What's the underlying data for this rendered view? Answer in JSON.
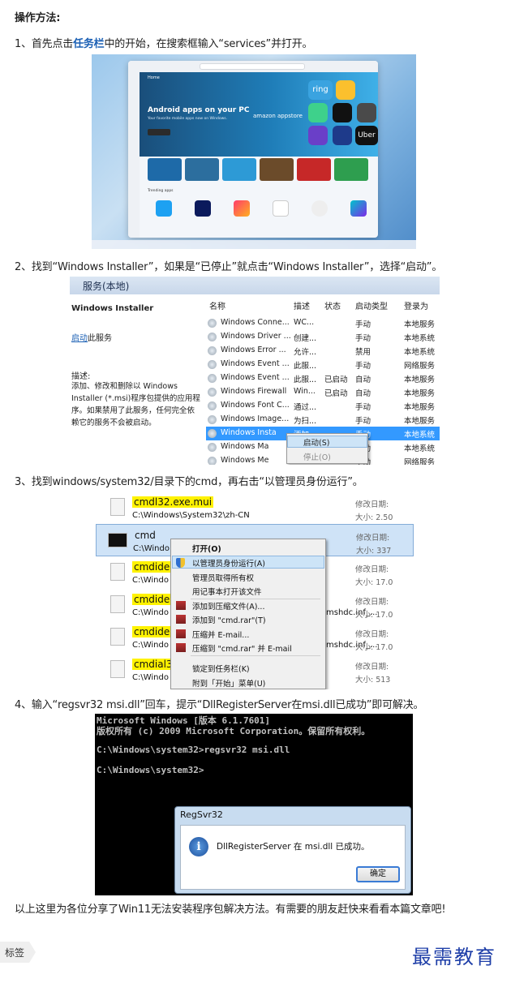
{
  "heading": "操作方法:",
  "steps": [
    {
      "pre": "1、首先点击",
      "highlight": "任务栏",
      "post": "中的开始，在搜索框输入“services”并打开。"
    },
    {
      "text": "2、找到“Windows Installer”，如果是“已停止”就点击“Windows Installer”，选择“启动”。"
    },
    {
      "text": "3、找到windows/system32/目录下的cmd，再右击“以管理员身份运行”。"
    },
    {
      "text": "4、输入“regsvr32 msi.dll”回车，提示“DllRegisterServer在msi.dll已成功”即可解决。"
    }
  ],
  "conclusion": "以上这里为各位分享了Win11无法安装程序包解决方法。有需要的朋友赶快来看看本篇文章吧!",
  "tag_label": "标签",
  "logo_text": "最需教育",
  "shot1": {
    "home": "Home",
    "hero_title": "Android apps on your PC",
    "hero_sub": "Your favorite mobile apps now on Windows.",
    "amazon": "amazon appstore",
    "trending": "Trending apps",
    "tiles": [
      "ring",
      "Uber"
    ]
  },
  "shot2": {
    "title": "服务(本地)",
    "service_name": "Windows Installer",
    "start_link": "启动",
    "start_suffix": "此服务",
    "desc_label": "描述:",
    "desc_lines": [
      "添加、修改和删除以 Windows",
      "Installer (*.msi)程序包提供的应用程",
      "序。如果禁用了此服务，任何完全依",
      "赖它的服务不会被启动。"
    ],
    "columns": [
      "名称",
      "描述",
      "状态",
      "启动类型",
      "登录为"
    ],
    "rows": [
      [
        "Windows Conne...",
        "WC...",
        "",
        "手动",
        "本地服务"
      ],
      [
        "Windows Driver ...",
        "创建...",
        "",
        "手动",
        "本地系统"
      ],
      [
        "Windows Error ...",
        "允许...",
        "",
        "禁用",
        "本地系统"
      ],
      [
        "Windows Event ...",
        "此服...",
        "",
        "手动",
        "网络服务"
      ],
      [
        "Windows Event ...",
        "此服...",
        "已启动",
        "自动",
        "本地服务"
      ],
      [
        "Windows Firewall",
        "Win...",
        "已启动",
        "自动",
        "本地服务"
      ],
      [
        "Windows Font C...",
        "通过...",
        "",
        "手动",
        "本地服务"
      ],
      [
        "Windows Image...",
        "为扫...",
        "",
        "手动",
        "本地服务"
      ],
      [
        "Windows Insta",
        "添加",
        "",
        "手动",
        "本地系统"
      ],
      [
        "Windows Ma",
        "",
        "",
        "手动",
        "本地系统"
      ],
      [
        "Windows Me",
        "",
        "",
        "手动",
        "网络服务"
      ]
    ],
    "menu": [
      "启动(S)",
      "停止(O)"
    ]
  },
  "shot3": {
    "files": [
      {
        "name": "cmdl32.exe.mui",
        "path": "C:\\Windows\\System32\\zh-CN",
        "meta1": "修改日期:",
        "meta2": "大小: 2.50"
      },
      {
        "name": "cmd",
        "path": "C:\\Windo",
        "meta1": "修改日期:",
        "meta2": "大小: 337"
      },
      {
        "name": "cmdide",
        "path": "C:\\Windo",
        "meta1": "修改日期:",
        "meta2": "大小: 17.0"
      },
      {
        "name": "cmdide",
        "path": "C:\\Windo",
        "extra": "mshdc.inf_...",
        "meta1": "修改日期:",
        "meta2": "大小: 17.0"
      },
      {
        "name": "cmdide",
        "path": "C:\\Windo",
        "extra": "mshdc.inf_...",
        "meta1": "修改日期:",
        "meta2": "大小: 17.0"
      },
      {
        "name": "cmdial3",
        "path": "C:\\Windo",
        "meta1": "修改日期:",
        "meta2": "大小: 513"
      }
    ],
    "menu": [
      "打开(O)",
      "以管理员身份运行(A)",
      "管理员取得所有权",
      "用记事本打开该文件",
      "添加到压缩文件(A)...",
      "添加到 \"cmd.rar\"(T)",
      "压缩并 E-mail...",
      "压缩到 \"cmd.rar\" 并 E-mail",
      "锁定到任务栏(K)",
      "附到「开始」菜单(U)"
    ]
  },
  "shot4": {
    "lines": [
      "Microsoft Windows [版本 6.1.7601]",
      "版权所有 (c) 2009 Microsoft Corporation。保留所有权利。",
      "C:\\Windows\\system32>regsvr32 msi.dll",
      "C:\\Windows\\system32>"
    ],
    "dialog_title": "RegSvr32",
    "dialog_message": "DllRegisterServer 在 msi.dll 已成功。",
    "ok": "确定"
  }
}
